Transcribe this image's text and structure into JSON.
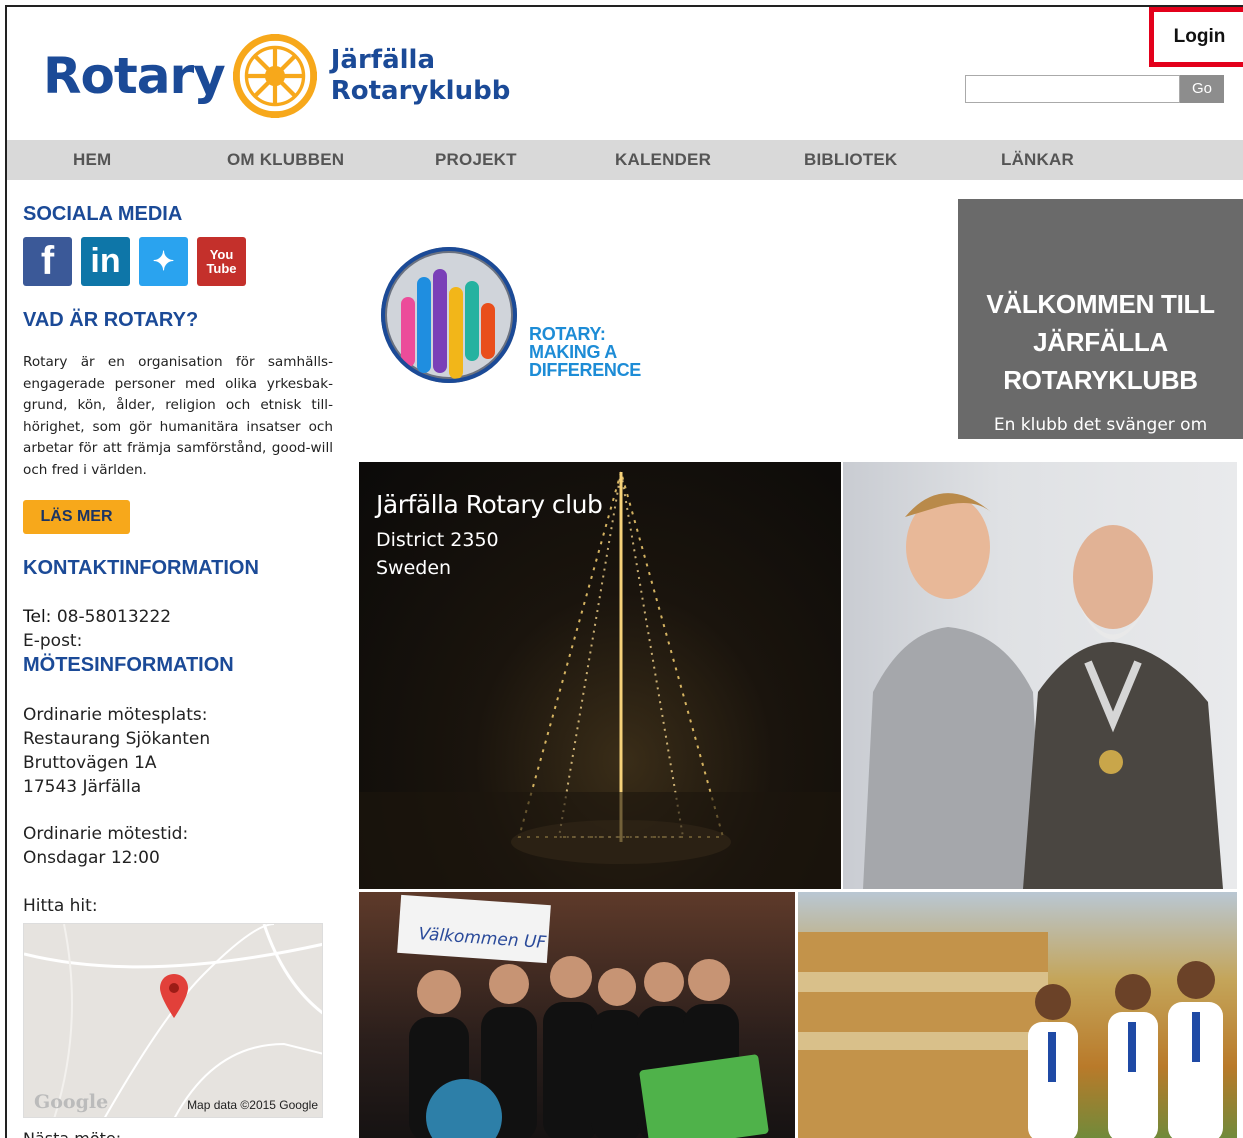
{
  "header": {
    "logo_rotary": "Rotary",
    "logo_club_line1": "Järfälla",
    "logo_club_line2": "Rotaryklubb",
    "login_label": "Login",
    "search_value": "",
    "search_button": "Go"
  },
  "nav": {
    "items": [
      "HEM",
      "OM KLUBBEN",
      "PROJEKT",
      "KALENDER",
      "BIBLIOTEK",
      "LÄNKAR"
    ]
  },
  "sidebar": {
    "social_title": "SOCIALA MEDIA",
    "social_icons": [
      "facebook-icon",
      "linkedin-icon",
      "twitter-icon",
      "youtube-icon"
    ],
    "youtube_line1": "You",
    "youtube_line2": "Tube",
    "about_title": "VAD ÄR ROTARY?",
    "about_text": "Rotary är en organisation för samhälls-engagerade personer med olika yrkesbak-grund, kön, ålder, religion och etnisk till-hörighet, som gör humanitära insatser och arbetar för att främja samförstånd, good-will och fred i världen.",
    "more_button": "LÄS MER",
    "contact_title": "KONTAKTINFORMATION",
    "tel_label": "Tel:",
    "tel_value": "08-58013222",
    "email_label": "E-post:",
    "meeting_title": "MÖTESINFORMATION",
    "place_label": "Ordinarie mötesplats:",
    "place_line1": "Restaurang Sjökanten",
    "place_line2": "Bruttovägen 1A",
    "place_line3": "17543 Järfälla",
    "time_label": "Ordinarie mötestid:",
    "time_value": "Onsdagar 12:00",
    "find_label": "Hitta hit:",
    "map_logo": "Google",
    "map_credit": "Map data ©2015 Google",
    "next_meeting_label": "Nästa möte:"
  },
  "main": {
    "rmad_line1": "ROTARY:",
    "rmad_line2": "MAKING A",
    "rmad_line3": "DIFFERENCE",
    "welcome_line1": "VÄLKOMMEN TILL",
    "welcome_line2": "JÄRFÄLLA",
    "welcome_line3": "ROTARYKLUBB",
    "welcome_sub": "En klubb det svänger om",
    "photo1_title": "Järfälla Rotary club",
    "photo1_line2": "District 2350",
    "photo1_line3": "Sweden",
    "photo3_sign": "Välkommen UF"
  },
  "colors": {
    "brand_blue": "#1b4a97",
    "rotary_gold": "#f7a81b",
    "login_highlight": "#e3001b",
    "nav_bg": "#d9d9d9",
    "welcome_bg": "#6a6a6a"
  }
}
